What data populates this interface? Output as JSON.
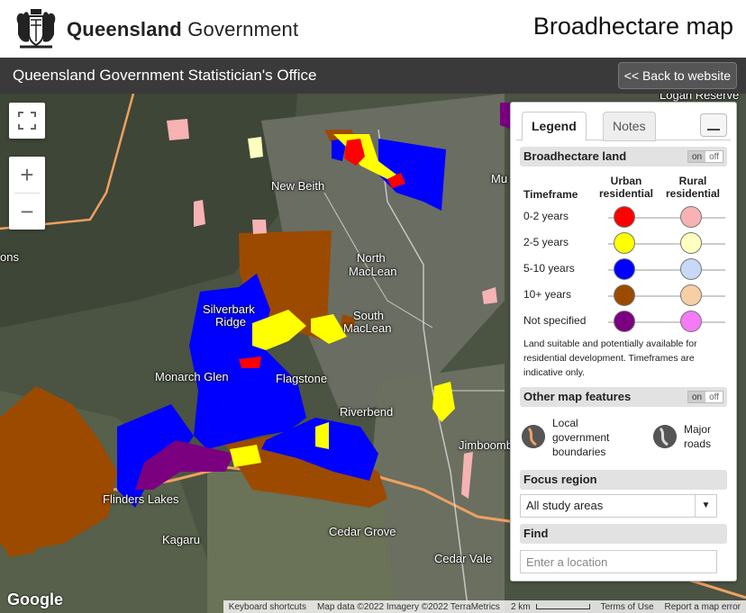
{
  "header": {
    "brand_bold": "Queensland",
    "brand_rest": " Government",
    "page_title": "Broadhectare map"
  },
  "subbar": {
    "title": "Queensland Government Statistician's Office",
    "back_label": "<< Back to website"
  },
  "map": {
    "places": [
      {
        "name": "New Beith"
      },
      {
        "name": "North"
      },
      {
        "name": "MacLean"
      },
      {
        "name": "South"
      },
      {
        "name": "MacLean"
      },
      {
        "name": "Silverbark"
      },
      {
        "name": "Ridge"
      },
      {
        "name": "Monarch Glen"
      },
      {
        "name": "Flagstone"
      },
      {
        "name": "Riverbend"
      },
      {
        "name": "Jimboomba"
      },
      {
        "name": "Flinders Lakes"
      },
      {
        "name": "Kagaru"
      },
      {
        "name": "Cedar Grove"
      },
      {
        "name": "Cedar Vale"
      },
      {
        "name": "ons"
      },
      {
        "name": "Mu"
      },
      {
        "name": "Logan Reserve"
      }
    ],
    "controls": {
      "zoom_in": "+",
      "zoom_out": "−"
    },
    "google": "Google",
    "attribution": [
      "Keyboard shortcuts",
      "Map data ©2022 Imagery ©2022 TerraMetrics",
      "2 km",
      "Terms of Use",
      "Report a map error"
    ]
  },
  "legend": {
    "tabs": [
      "Legend",
      "Notes"
    ],
    "broadhectare_title": "Broadhectare  land",
    "toggle_on": "on",
    "toggle_off": "off",
    "col_timeframe": "Timeframe",
    "col_urban": "Urban residential",
    "col_rural": "Rural residential",
    "rows": [
      {
        "label": "0-2 years",
        "urban": "#ff0000",
        "rural": "#f7b3b3"
      },
      {
        "label": "2-5 years",
        "urban": "#ffff00",
        "rural": "#ffffbf"
      },
      {
        "label": "5-10 years",
        "urban": "#0000ff",
        "rural": "#c8d8f7"
      },
      {
        "label": "10+ years",
        "urban": "#9c4a00",
        "rural": "#f7cfa5"
      },
      {
        "label": "Not specified",
        "urban": "#7a0080",
        "rural": "#f57af5"
      }
    ],
    "note": "Land suitable and potentially available for residential development. Timeframes are indicative only.",
    "other_title": "Other map features",
    "lga_label": "Local government boundaries",
    "roads_label": "Major roads",
    "focus_title": "Focus region",
    "focus_value": "All study areas",
    "find_title": "Find",
    "find_placeholder": "Enter a location"
  }
}
